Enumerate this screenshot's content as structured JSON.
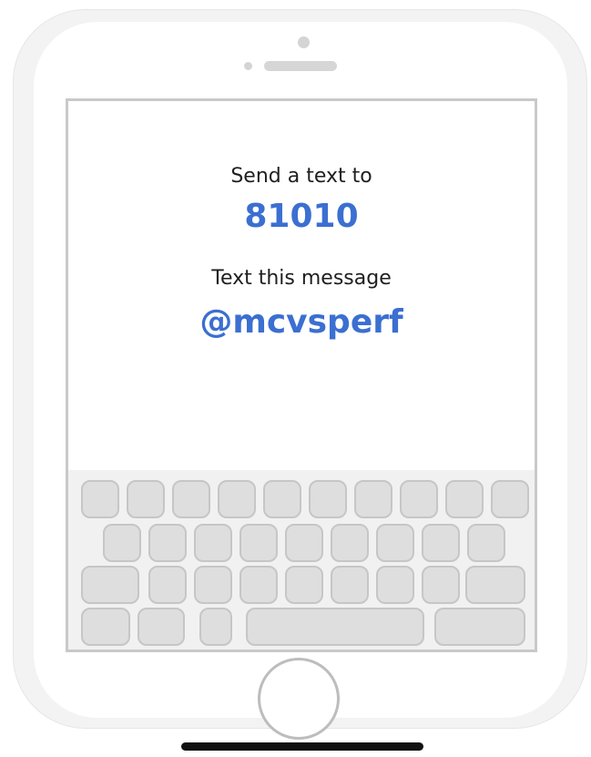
{
  "message": {
    "send_label": "Send a text to",
    "shortcode": "81010",
    "text_label": "Text this message",
    "keyword": "@mcvsperf"
  },
  "colors": {
    "accent": "#3b6fd1",
    "text": "#1f1f1f",
    "key_fill": "#dedede",
    "key_border": "#c6c6c6",
    "keyboard_bg": "#f1f1f1"
  },
  "icons": {
    "camera": "camera-icon",
    "sensor": "sensor-icon",
    "speaker": "speaker-icon",
    "home_button": "home-button-icon"
  }
}
